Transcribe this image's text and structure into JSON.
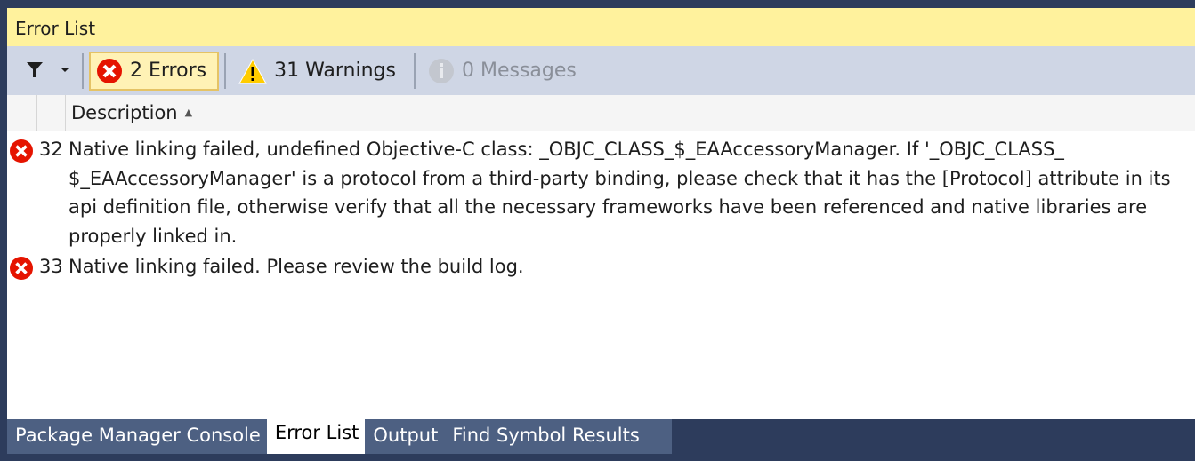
{
  "window": {
    "title": "Error List"
  },
  "toolbar": {
    "filter_icon": "filter-icon",
    "errors_label": "2 Errors",
    "warnings_label": "31 Warnings",
    "messages_label": "0 Messages"
  },
  "columns": {
    "description": "Description"
  },
  "rows": [
    {
      "icon": "error-icon",
      "line": "32",
      "description": "Native linking failed, undefined Objective-C class: _OBJC_CLASS_$_EAAccessoryManager. If '_OBJC_CLASS_ $_EAAccessoryManager' is a protocol from a third-party binding, please check that it has the [Protocol] attribute in its api definition file, otherwise verify that all the necessary frameworks have been referenced and native libraries are properly linked in."
    },
    {
      "icon": "error-icon",
      "line": "33",
      "description": "Native linking failed. Please review the build log."
    }
  ],
  "tabs": [
    {
      "label": "Package Manager Console"
    },
    {
      "label": "Error List",
      "active": true
    },
    {
      "label": "Output"
    },
    {
      "label": "Find Symbol Results"
    }
  ],
  "colors": {
    "title_bg": "#fff29d",
    "toolbar_bg": "#cfd6e5",
    "frame": "#2d3c5c",
    "tab_bg": "#4d6082",
    "error": "#e51400",
    "warning": "#ffcc00"
  }
}
